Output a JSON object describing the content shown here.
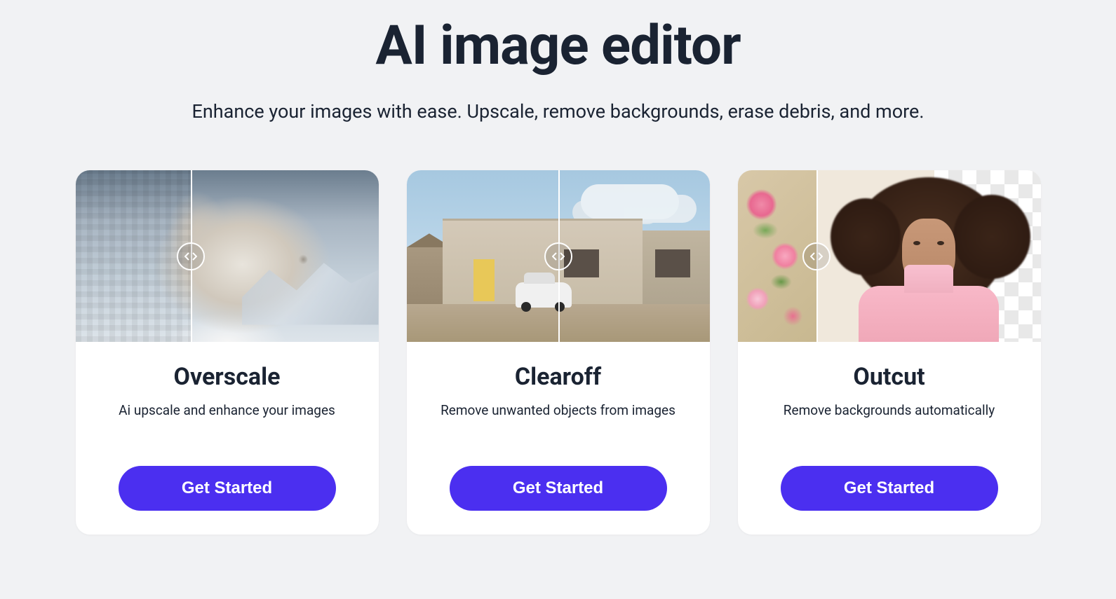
{
  "hero": {
    "title": "AI image editor",
    "subtitle": "Enhance your images with ease. Upscale, remove backgrounds, erase debris, and more."
  },
  "cards": [
    {
      "title": "Overscale",
      "description": "Ai upscale and enhance your images",
      "cta": "Get Started",
      "icon": "compare-slider-icon"
    },
    {
      "title": "Clearoff",
      "description": "Remove unwanted objects from images",
      "cta": "Get Started",
      "icon": "compare-slider-icon"
    },
    {
      "title": "Outcut",
      "description": "Remove backgrounds automatically",
      "cta": "Get Started",
      "icon": "compare-slider-icon"
    }
  ],
  "colors": {
    "accent": "#4b2ff0",
    "text": "#1a2332",
    "bg": "#f1f2f4"
  }
}
